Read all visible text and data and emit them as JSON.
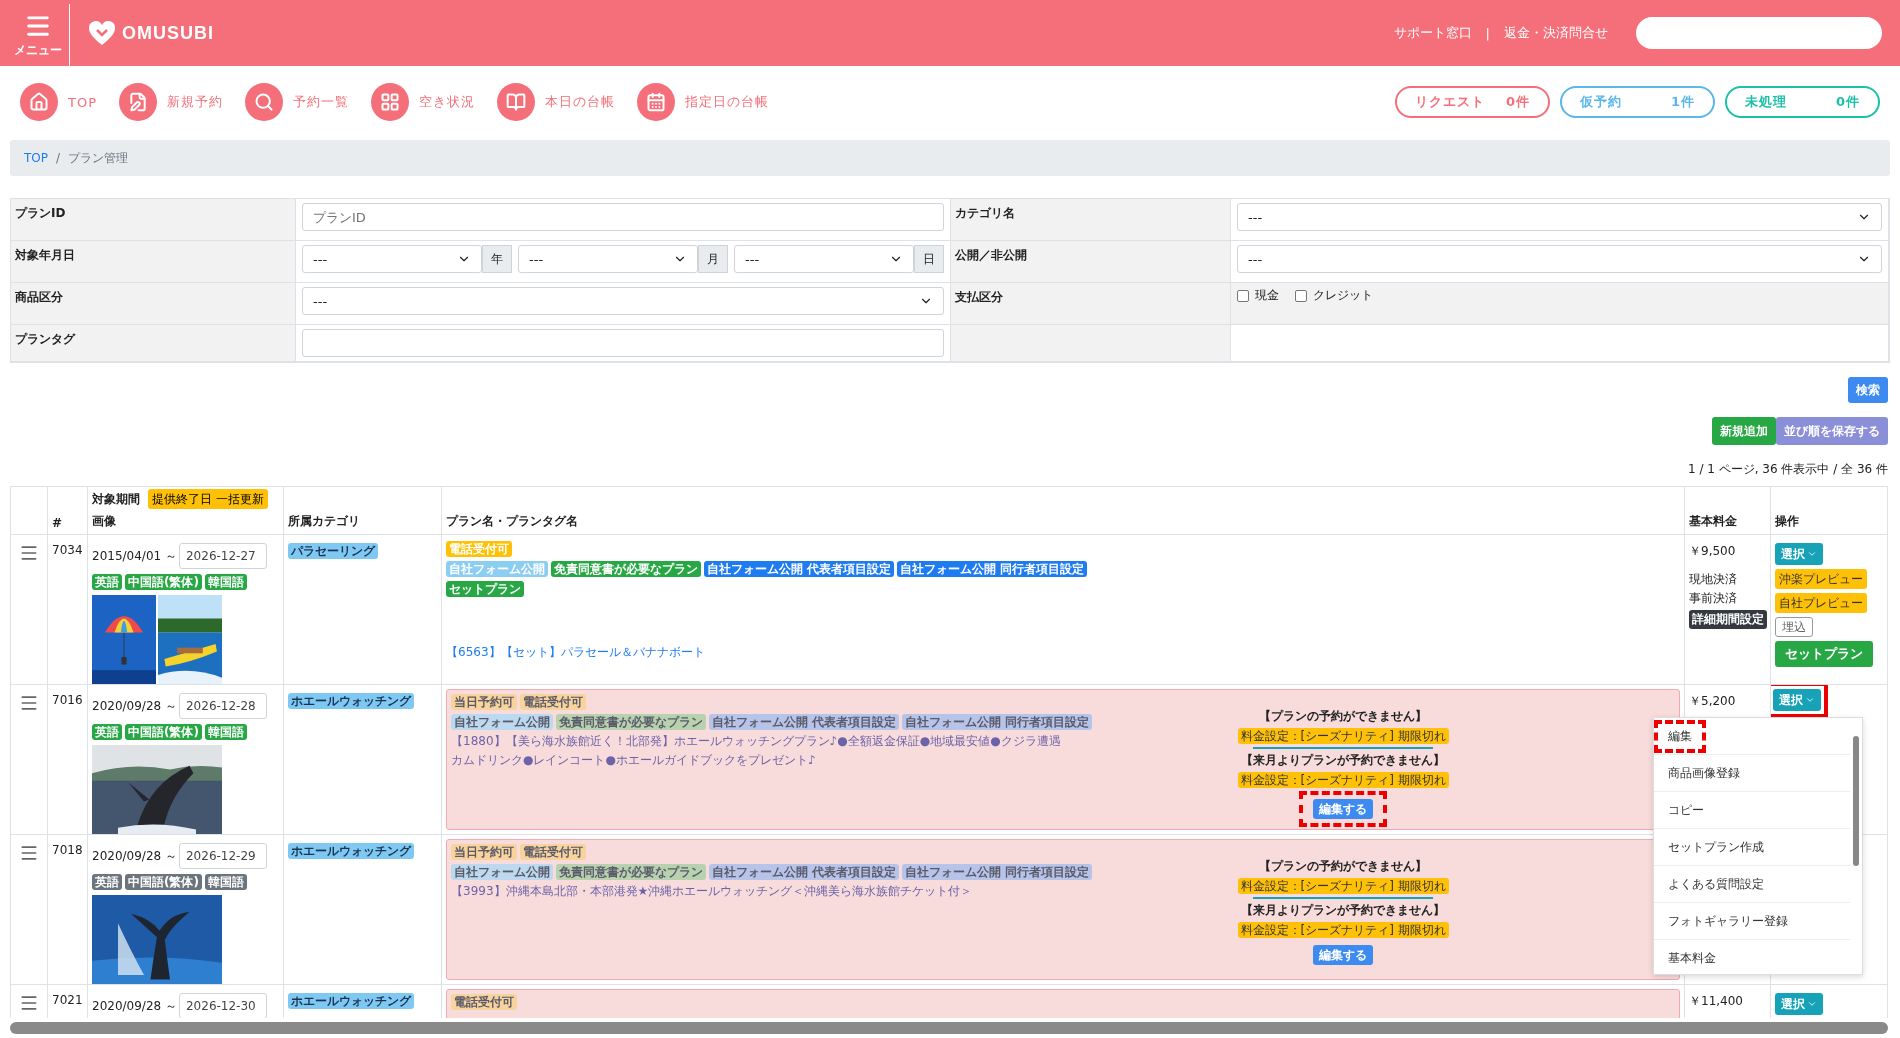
{
  "header": {
    "menu_label": "メニュー",
    "logo": "OMUSUBI",
    "links": [
      "サポート窓口",
      "返金・決済問合せ"
    ],
    "separator": "|"
  },
  "nav": [
    {
      "label": "TOP"
    },
    {
      "label": "新規予約"
    },
    {
      "label": "予約一覧"
    },
    {
      "label": "空き状況"
    },
    {
      "label": "本日の台帳"
    },
    {
      "label": "指定日の台帳"
    }
  ],
  "counters": [
    {
      "label": "リクエスト",
      "count": "0件",
      "color": "#f46f79"
    },
    {
      "label": "仮予約",
      "count": "1件",
      "color": "#5bb6ec"
    },
    {
      "label": "未処理",
      "count": "0件",
      "color": "#1cc0a6"
    }
  ],
  "breadcrumb": {
    "items": [
      {
        "label": "TOP",
        "link": true
      },
      {
        "label": "プラン管理",
        "link": false
      }
    ],
    "separator": "/"
  },
  "filters": [
    [
      {
        "label": "プランID",
        "kind": "text",
        "placeholder": "プランID"
      },
      {
        "label": "カテゴリ名",
        "kind": "select",
        "value": "---"
      }
    ],
    [
      {
        "label": "対象年月日",
        "kind": "date",
        "parts": [
          {
            "value": "---",
            "unit": "年"
          },
          {
            "value": "---",
            "unit": "月"
          },
          {
            "value": "---",
            "unit": "日"
          }
        ]
      },
      {
        "label": "公開／非公開",
        "kind": "select",
        "value": "---"
      }
    ],
    [
      {
        "label": "商品区分",
        "kind": "select",
        "value": "---"
      },
      {
        "label": "支払区分",
        "kind": "checks",
        "options": [
          {
            "label": "現金",
            "checked": false
          },
          {
            "label": "クレジット",
            "checked": false
          }
        ]
      }
    ],
    [
      {
        "label": "プランタグ",
        "kind": "text"
      }
    ]
  ],
  "search_button": "検索",
  "actions": [
    {
      "label": "新規追加",
      "color": "#28a745"
    },
    {
      "label": "並び順を保存する",
      "color": "#8a8fd8"
    }
  ],
  "pagination": "1 / 1 ページ, 36 件表示中 / 全 36 件",
  "table": {
    "columns": [
      {
        "label": "#"
      },
      {
        "label": "対象期間",
        "sublabel": "画像",
        "button": "提供終了日 一括更新"
      },
      {
        "label": "所属カテゴリ"
      },
      {
        "label": "プラン名・プランタグ名"
      },
      {
        "label": "基本料金"
      },
      {
        "label": "操作"
      }
    ],
    "rows": [
      {
        "id": "7034",
        "start": "2015/04/01 ～",
        "end": "2026-12-27",
        "languages": [
          {
            "label": "英語",
            "active": true
          },
          {
            "label": "中国語(繁体)",
            "active": true
          },
          {
            "label": "韓国語",
            "active": true
          }
        ],
        "images": [
          {
            "kind": "picture"
          },
          {
            "kind": "picture"
          }
        ],
        "categories": [
          "パラセーリング"
        ],
        "disabled": false,
        "tags": [
          [
            {
              "label": "電話受付可",
              "color": "#ffc107"
            }
          ],
          [
            {
              "label": "自社フォーム公開",
              "color": "#8ccdf2"
            },
            {
              "label": "免責同意書が必要なプラン",
              "color": "#28a745"
            },
            {
              "label": "自社フォーム公開 代表者項目設定",
              "color": "#1e7bf0"
            },
            {
              "label": "自社フォーム公開 同行者項目設定",
              "color": "#1e7bf0"
            }
          ],
          [
            {
              "label": "セットプラン",
              "color": "#28a745"
            }
          ]
        ],
        "name_parts": [
          "【6563】【セット】パラセール＆バナナボート"
        ],
        "notices": [],
        "price": "￥9,500",
        "payments": [
          "現地決済",
          "事前決済"
        ],
        "period_badge": "詳細期間設定",
        "ops": [
          {
            "kind": "select",
            "label": "選択"
          },
          {
            "kind": "preview",
            "label": "沖楽プレビュー"
          },
          {
            "kind": "preview",
            "label": "自社プレビュー"
          },
          {
            "kind": "embed",
            "label": "埋込"
          },
          {
            "kind": "set",
            "label": "セットプラン"
          }
        ]
      },
      {
        "id": "7016",
        "start": "2020/09/28 ～",
        "end": "2026-12-28",
        "languages": [
          {
            "label": "英語",
            "active": true
          },
          {
            "label": "中国語(繁体)",
            "active": true
          },
          {
            "label": "韓国語",
            "active": true
          }
        ],
        "images": [
          {
            "kind": "picture"
          }
        ],
        "categories": [
          "ホエールウォッチング"
        ],
        "disabled": true,
        "tags": [
          [
            {
              "label": "当日予約可",
              "color": "#f8d39c"
            },
            {
              "label": "電話受付可",
              "color": "#f8d39c"
            }
          ],
          [
            {
              "label": "自社フォーム公開",
              "color": "#bcd9ef"
            },
            {
              "label": "免責同意書が必要なプラン",
              "color": "#b8d2b0"
            },
            {
              "label": "自社フォーム公開 代表者項目設定",
              "color": "#b7c4ea"
            },
            {
              "label": "自社フォーム公開 同行者項目設定",
              "color": "#b7c4ea"
            }
          ]
        ],
        "name_parts": [
          "【1880】【美ら海水族館近く！北部発】ホエールウォッチングプラン♪●全額返金保証●地域最安値●クジラ遭遇",
          "カムドリンク●レインコート●ホエールガイドブックをプレゼント♪"
        ],
        "notices": [
          {
            "title": "【プランの予約ができません】",
            "badge": "料金設定：[シーズナリティ] 期限切れ"
          },
          {
            "title": "【来月よりプランが予約できません】",
            "badge": "料金設定：[シーズナリティ] 期限切れ"
          }
        ],
        "edit_button": {
          "label": "編集する",
          "highlight": {
            "kind": "dashed"
          }
        },
        "price": "￥5,200",
        "ops": [
          {
            "kind": "select",
            "label": "選択",
            "highlight": {
              "kind": "solid"
            }
          }
        ]
      },
      {
        "id": "7018",
        "start": "2020/09/28 ～",
        "end": "2026-12-29",
        "languages": [
          {
            "label": "英語",
            "active": false
          },
          {
            "label": "中国語(繁体)",
            "active": false
          },
          {
            "label": "韓国語",
            "active": false
          }
        ],
        "images": [
          {
            "kind": "picture"
          }
        ],
        "categories": [
          "ホエールウォッチング"
        ],
        "disabled": true,
        "tags": [
          [
            {
              "label": "当日予約可",
              "color": "#f8d39c"
            },
            {
              "label": "電話受付可",
              "color": "#f8d39c"
            }
          ],
          [
            {
              "label": "自社フォーム公開",
              "color": "#bcd9ef"
            },
            {
              "label": "免責同意書が必要なプラン",
              "color": "#b8d2b0"
            },
            {
              "label": "自社フォーム公開 代表者項目設定",
              "color": "#b7c4ea"
            },
            {
              "label": "自社フォーム公開 同行者項目設定",
              "color": "#b7c4ea"
            }
          ]
        ],
        "name_parts": [
          "【3993】沖縄本島北部・本部港発★沖縄ホエールウォッチング＜沖縄美ら海水族館チケット付＞"
        ],
        "notices": [
          {
            "title": "【プランの予約ができません】",
            "badge": "料金設定：[シーズナリティ] 期限切れ"
          },
          {
            "title": "【来月よりプランが予約できません】",
            "badge": "料金設定：[シーズナリティ] 期限切れ"
          }
        ],
        "edit_button": {
          "label": "編集する"
        },
        "ops": []
      },
      {
        "id": "7021",
        "start": "2020/09/28 ～",
        "end": "2026-12-30",
        "languages": [],
        "images": [],
        "categories": [
          "ホエールウォッチング"
        ],
        "disabled": true,
        "tags": [
          [
            {
              "label": "電話受付可",
              "color": "#f8d39c"
            }
          ]
        ],
        "name_parts": [],
        "notices": [],
        "price": "￥11,400",
        "ops": [
          {
            "kind": "select",
            "label": "選択"
          }
        ]
      }
    ]
  },
  "menu": {
    "items": [
      {
        "label": "編集",
        "highlight": {
          "kind": "dashed"
        }
      },
      {
        "label": "商品画像登録"
      },
      {
        "label": "コピー"
      },
      {
        "label": "セットプラン作成"
      },
      {
        "label": "よくある質問設定"
      },
      {
        "label": "フォトギャラリー登録"
      },
      {
        "label": "基本料金"
      }
    ]
  }
}
